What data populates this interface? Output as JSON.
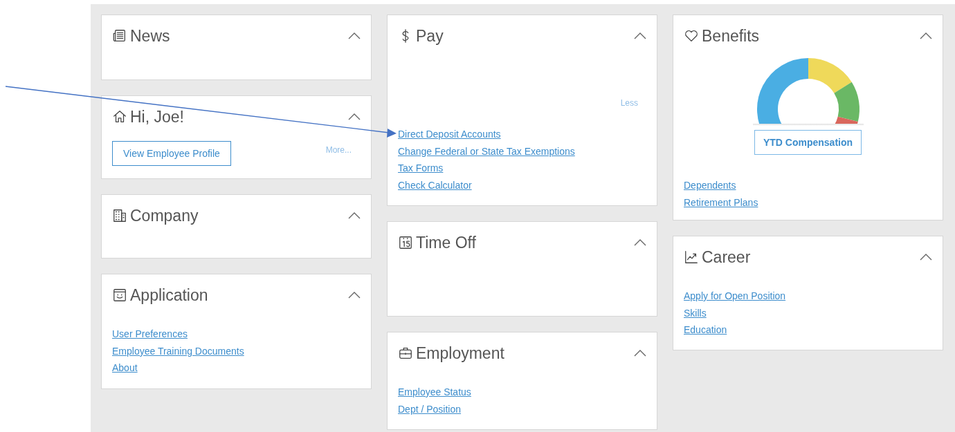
{
  "columns": [
    [
      {
        "title": "News",
        "expanded": true
      },
      {
        "title": "Hi, Joe!",
        "expanded": true,
        "button": "View Employee Profile",
        "more_link": "More..."
      },
      {
        "title": "Company",
        "expanded": true
      },
      {
        "title": "Application",
        "expanded": true,
        "links": [
          "User Preferences",
          "Employee Training Documents",
          "About"
        ]
      }
    ],
    [
      {
        "title": "Pay",
        "expanded": true,
        "less_link": "Less",
        "links": [
          "Direct Deposit Accounts",
          "Change Federal or State Tax Exemptions",
          "Tax Forms",
          "Check Calculator"
        ]
      },
      {
        "title": "Time Off",
        "expanded": true
      },
      {
        "title": "Employment",
        "expanded": true,
        "links": [
          "Employee Status",
          "Dept / Position"
        ]
      }
    ],
    [
      {
        "title": "Benefits",
        "expanded": true,
        "gauge": true,
        "button": "YTD Compensation",
        "links": [
          "Dependents",
          "Retirement Plans"
        ]
      },
      {
        "title": "Career",
        "expanded": true,
        "links": [
          "Apply for Open Position",
          "Skills",
          "Education"
        ]
      }
    ]
  ]
}
